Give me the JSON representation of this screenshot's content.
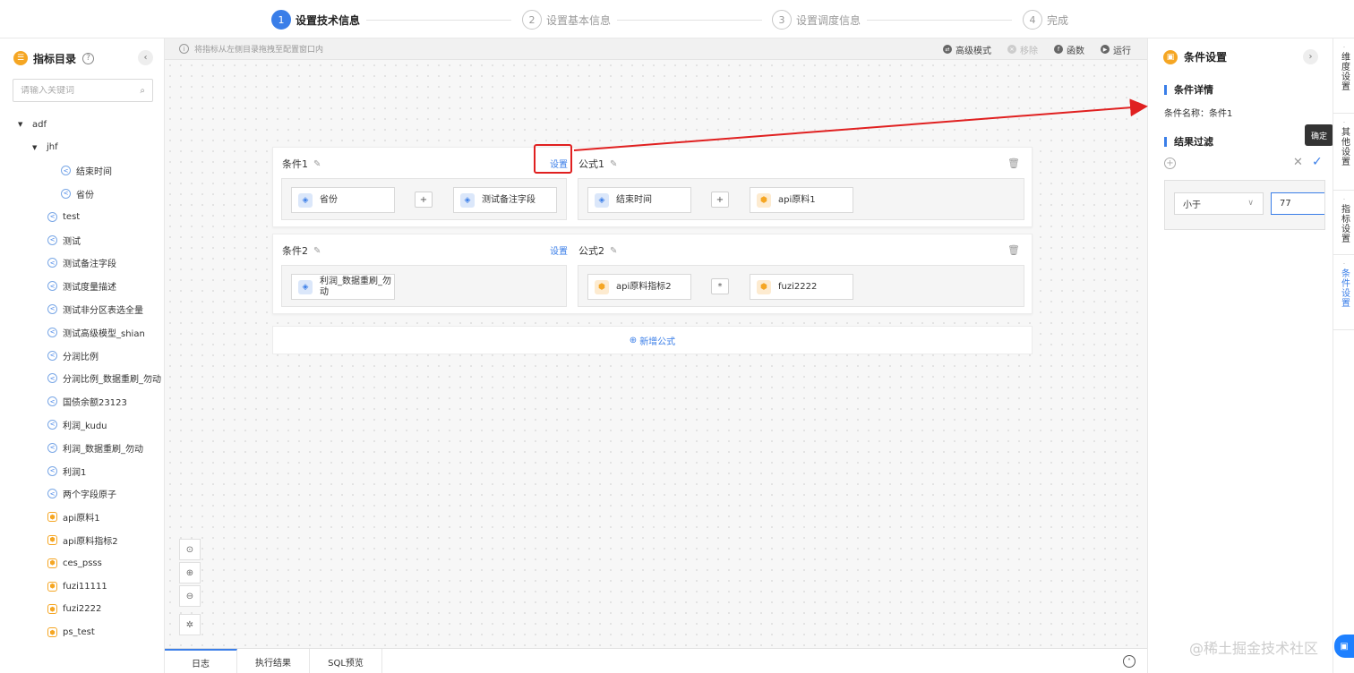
{
  "steps": [
    {
      "num": "1",
      "label": "设置技术信息"
    },
    {
      "num": "2",
      "label": "设置基本信息"
    },
    {
      "num": "3",
      "label": "设置调度信息"
    },
    {
      "num": "4",
      "label": "完成"
    }
  ],
  "sidebar": {
    "title": "指标目录",
    "help_icon": "question-icon",
    "search_placeholder": "请输入关键词",
    "tree": [
      {
        "label": "adf",
        "kind": "folder",
        "level": 0
      },
      {
        "label": "jhf",
        "kind": "folder",
        "level": 1
      },
      {
        "label": "结束时间",
        "kind": "dim",
        "level": 2
      },
      {
        "label": "省份",
        "kind": "dim",
        "level": 2
      },
      {
        "label": "test",
        "kind": "dim",
        "level": 1
      },
      {
        "label": "测试",
        "kind": "dim",
        "level": 1
      },
      {
        "label": "测试备注字段",
        "kind": "dim",
        "level": 1
      },
      {
        "label": "测试度量描述",
        "kind": "dim",
        "level": 1
      },
      {
        "label": "测试非分区表选全量",
        "kind": "dim",
        "level": 1
      },
      {
        "label": "测试高级模型_shian",
        "kind": "dim",
        "level": 1
      },
      {
        "label": "分润比例",
        "kind": "dim",
        "level": 1
      },
      {
        "label": "分润比例_数据重刷_勿动",
        "kind": "dim",
        "level": 1
      },
      {
        "label": "国债余额23123",
        "kind": "dim",
        "level": 1
      },
      {
        "label": "利润_kudu",
        "kind": "dim",
        "level": 1
      },
      {
        "label": "利润_数据重刷_勿动",
        "kind": "dim",
        "level": 1
      },
      {
        "label": "利润1",
        "kind": "dim",
        "level": 1
      },
      {
        "label": "两个字段原子",
        "kind": "dim",
        "level": 1
      },
      {
        "label": "api原料1",
        "kind": "metric",
        "level": 1
      },
      {
        "label": "api原料指标2",
        "kind": "metric",
        "level": 1
      },
      {
        "label": "ces_psss",
        "kind": "metric",
        "level": 1
      },
      {
        "label": "fuzi11111",
        "kind": "metric",
        "level": 1
      },
      {
        "label": "fuzi2222",
        "kind": "metric",
        "level": 1
      },
      {
        "label": "ps_test",
        "kind": "metric",
        "level": 1
      }
    ]
  },
  "canvas": {
    "hint": "将指标从左侧目录拖拽至配置窗口内",
    "tools": [
      {
        "label": "高级模式",
        "icon": "swap-icon",
        "disabled": false
      },
      {
        "label": "移除",
        "icon": "trash-icon",
        "disabled": true
      },
      {
        "label": "函数",
        "icon": "function-icon",
        "disabled": false
      },
      {
        "label": "运行",
        "icon": "play-icon",
        "disabled": false
      }
    ],
    "blocks": [
      {
        "condition": {
          "title": "条件1",
          "set_label": "设置",
          "items": [
            "省份",
            "测试备注字段"
          ],
          "op": "+"
        },
        "formula": {
          "title": "公式1",
          "items": [
            "结束时间",
            "api原料1"
          ],
          "op": "+"
        }
      },
      {
        "condition": {
          "title": "条件2",
          "set_label": "设置",
          "items": [
            "利润_数据重刷_勿动"
          ],
          "op": ""
        },
        "formula": {
          "title": "公式2",
          "items": [
            "api原料指标2",
            "fuzi2222"
          ],
          "op": "*"
        }
      }
    ],
    "add_formula": "新增公式"
  },
  "bottom_tabs": [
    "日志",
    "执行结果",
    "SQL预览"
  ],
  "panel": {
    "title": "条件设置",
    "detail_heading": "条件详情",
    "name_label": "条件名称：",
    "name_value": "条件1",
    "filter_heading": "结果过滤",
    "tooltip": "确定",
    "operator": "小于",
    "value": "77"
  },
  "vertical_tabs": [
    "维度设置",
    "其他设置",
    "指标设置",
    "条件设置"
  ],
  "watermark": "@稀土掘金技术社区",
  "colors": {
    "accent": "#3a7ee8",
    "orange": "#f5a623",
    "arrow": "#e02020"
  }
}
